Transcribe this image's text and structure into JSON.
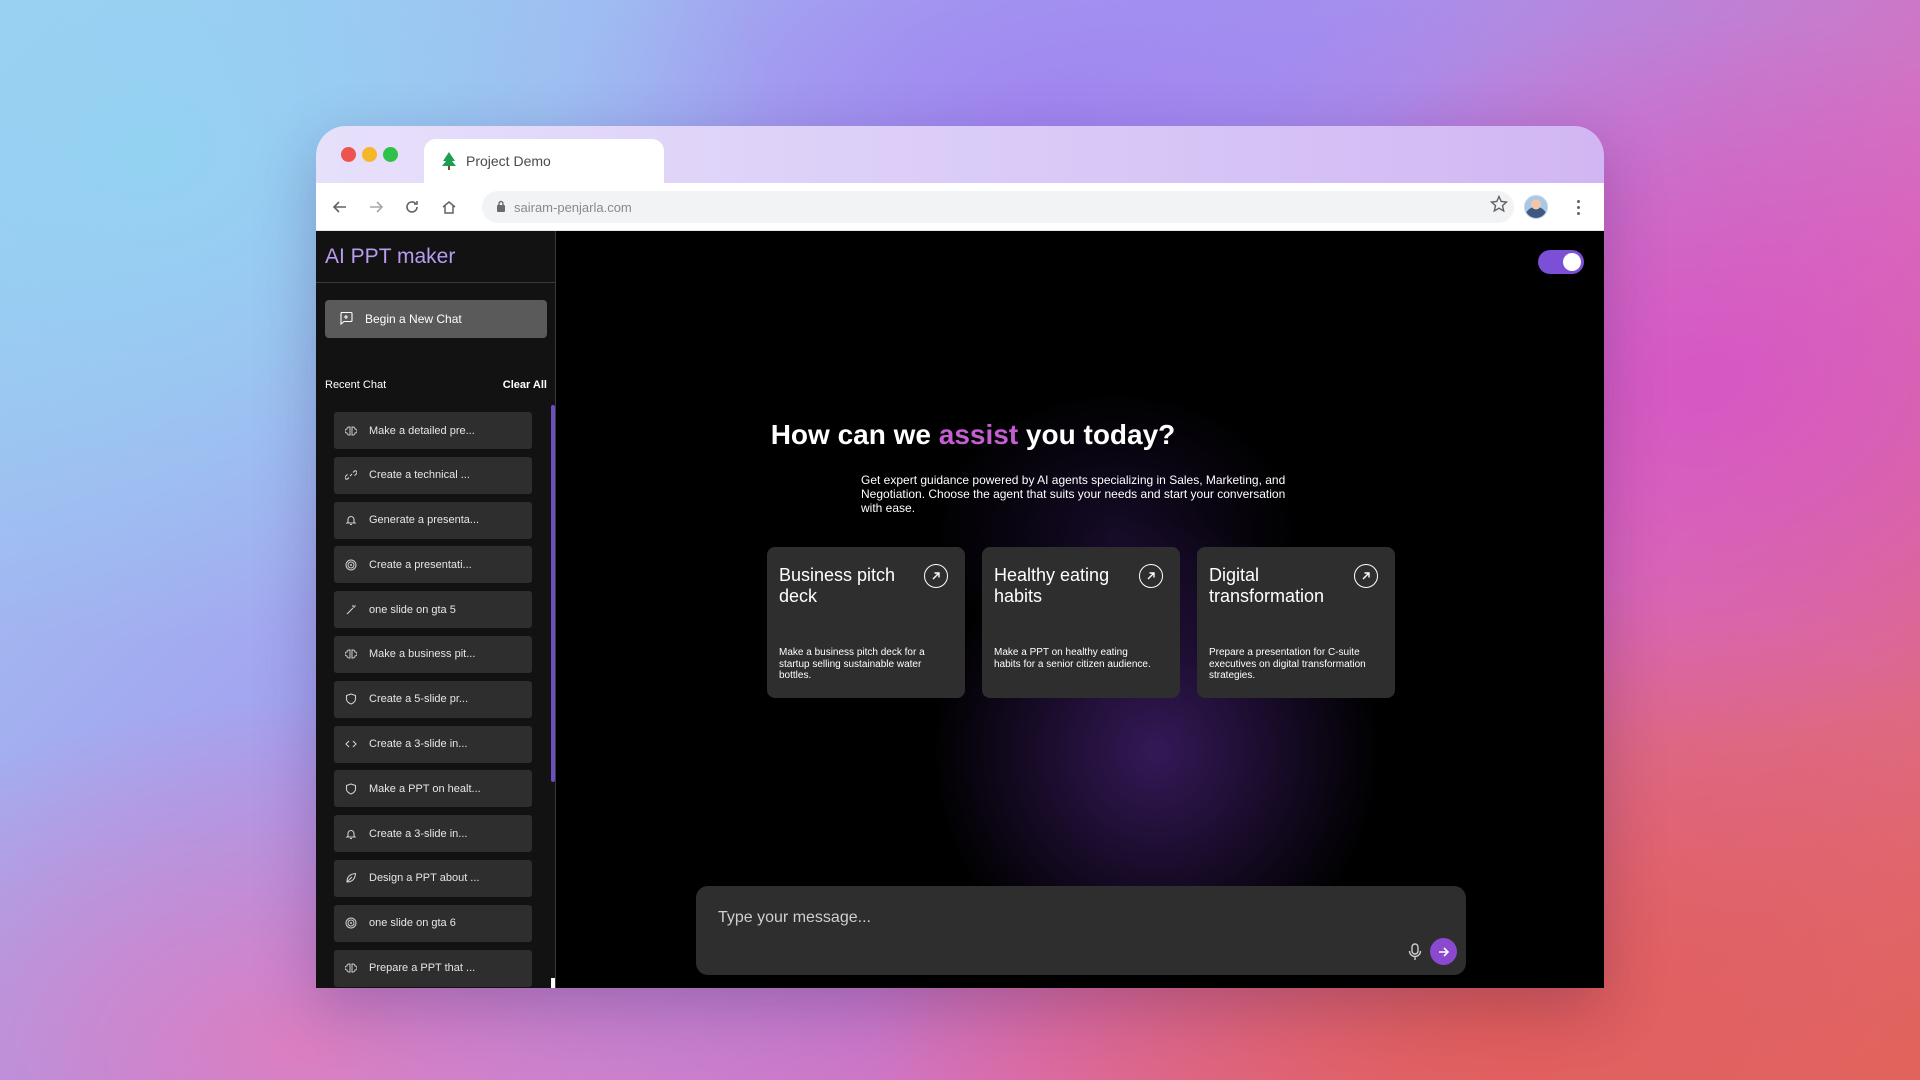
{
  "browser": {
    "tab_title": "Project Demo",
    "url": "sairam-penjarla.com"
  },
  "sidebar": {
    "brand": "AI PPT maker",
    "new_chat_label": "Begin a New Chat",
    "recent_label": "Recent Chat",
    "clear_label": "Clear All",
    "chats": [
      {
        "label": "Make a detailed pre...",
        "icon": "brain-icon"
      },
      {
        "label": "Create a technical ...",
        "icon": "link-icon"
      },
      {
        "label": "Generate a presenta...",
        "icon": "bell-icon"
      },
      {
        "label": "Create a presentati...",
        "icon": "target-icon"
      },
      {
        "label": "one slide on gta 5",
        "icon": "wand-icon"
      },
      {
        "label": "Make a business pit...",
        "icon": "brain-icon"
      },
      {
        "label": "Create a 5-slide pr...",
        "icon": "shield-icon"
      },
      {
        "label": "Create a 3-slide in...",
        "icon": "code-icon"
      },
      {
        "label": "Make a PPT on healt...",
        "icon": "shield-icon"
      },
      {
        "label": "Create a 3-slide in...",
        "icon": "bell-icon"
      },
      {
        "label": "Design a PPT about ...",
        "icon": "leaf-icon"
      },
      {
        "label": "one slide on gta 6",
        "icon": "target-icon"
      },
      {
        "label": "Prepare a PPT that ...",
        "icon": "brain-icon"
      }
    ]
  },
  "main": {
    "headline_before": "How can we ",
    "headline_accent": "assist",
    "headline_after": " you today?",
    "subtext": "Get expert guidance powered by AI agents specializing in Sales, Marketing, and Negotiation. Choose the agent that suits your needs and start your conversation with ease.",
    "cards": [
      {
        "title": "Business pitch deck",
        "desc": "Make a business pitch deck for a startup selling sustainable water bottles."
      },
      {
        "title": "Healthy eating habits",
        "desc": "Make a PPT on healthy eating habits for a senior citizen audience."
      },
      {
        "title": "Digital transformation",
        "desc": "Prepare a presentation for C-suite executives on digital transformation strategies."
      }
    ],
    "composer_placeholder": "Type your message..."
  },
  "colors": {
    "accent": "#c45ed1",
    "brand": "#b79cf0",
    "toggle": "#7b4fd6",
    "send": "#8a49cf"
  }
}
